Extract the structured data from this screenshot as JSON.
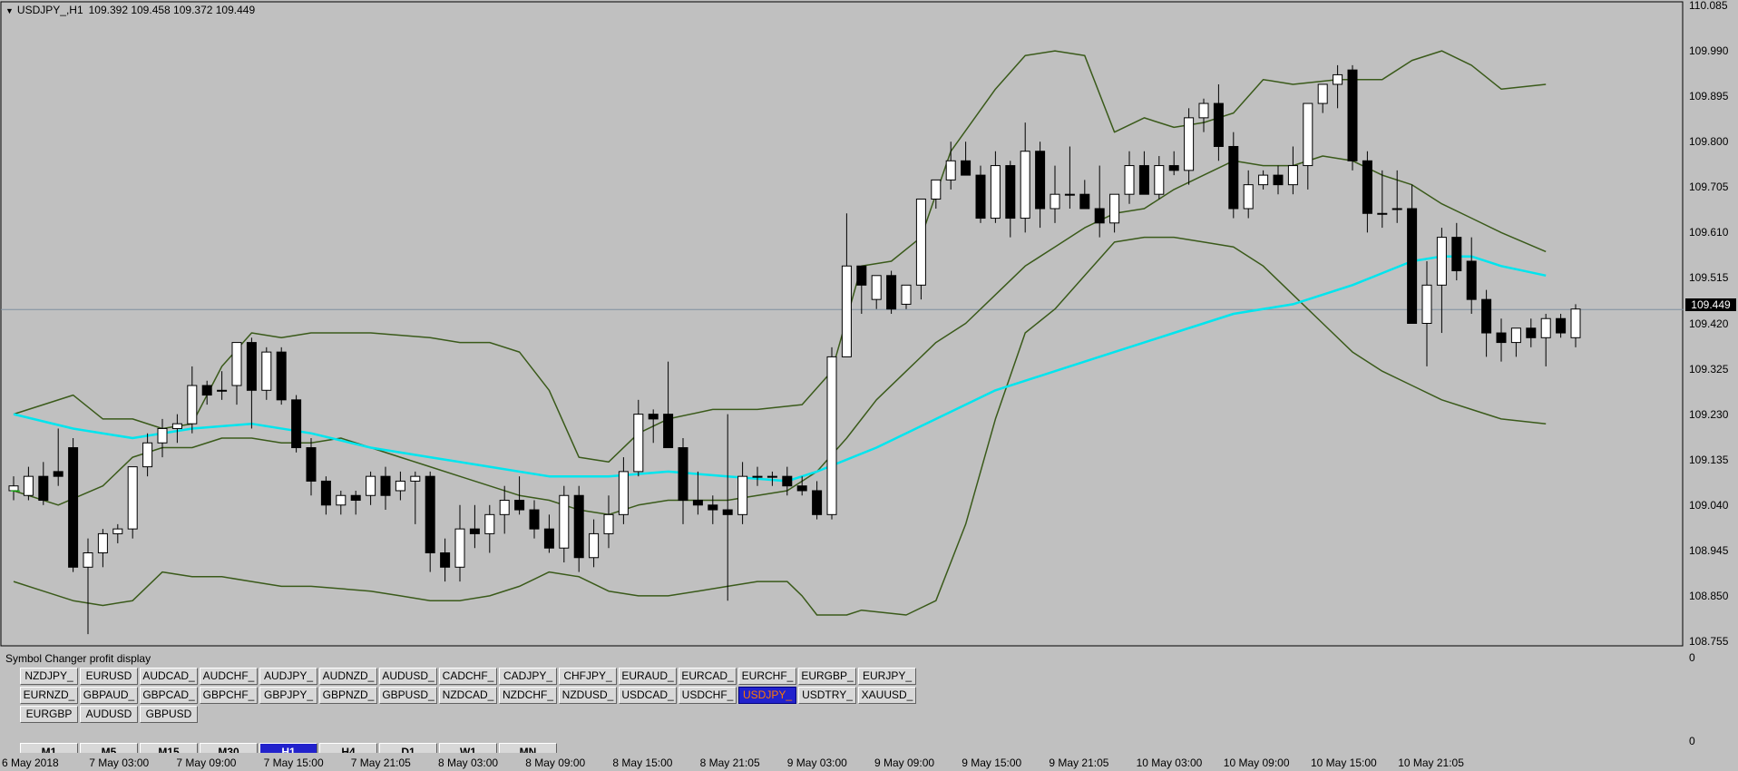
{
  "chart": {
    "symbol_title": "USDJPY_,H1",
    "ohlc": "109.392 109.458 109.372 109.449",
    "current_price": "109.449",
    "colors": {
      "background": "#c0c0c0",
      "bollinger": "#3a5a1a",
      "moving_average": "#00e5ee",
      "bull_candle": "#ffffff",
      "bear_candle": "#000000",
      "bid_line": "#7f90a0"
    },
    "price_axis": [
      "110.085",
      "109.990",
      "109.895",
      "109.800",
      "109.705",
      "109.610",
      "109.515",
      "109.420",
      "109.325",
      "109.230",
      "109.135",
      "109.040",
      "108.945",
      "108.850",
      "108.755"
    ],
    "time_axis": [
      "6 May 2018",
      "7 May 03:00",
      "7 May 09:00",
      "7 May 15:00",
      "7 May 21:05",
      "8 May 03:00",
      "8 May 09:00",
      "8 May 15:00",
      "8 May 21:05",
      "9 May 03:00",
      "9 May 09:00",
      "9 May 15:00",
      "9 May 21:05",
      "10 May 03:00",
      "10 May 09:00",
      "10 May 15:00",
      "10 May 21:05"
    ]
  },
  "chart_data": {
    "type": "candlestick",
    "ylim": [
      108.735,
      110.095
    ],
    "candles": [
      [
        109.07,
        109.1,
        109.05,
        109.08
      ],
      [
        109.06,
        109.12,
        109.05,
        109.1
      ],
      [
        109.1,
        109.13,
        109.04,
        109.05
      ],
      [
        109.11,
        109.2,
        109.08,
        109.1
      ],
      [
        109.16,
        109.18,
        108.9,
        108.91
      ],
      [
        108.91,
        108.97,
        108.77,
        108.94
      ],
      [
        108.94,
        108.99,
        108.91,
        108.98
      ],
      [
        108.98,
        109.0,
        108.96,
        108.99
      ],
      [
        108.99,
        109.12,
        108.97,
        109.12
      ],
      [
        109.12,
        109.19,
        109.1,
        109.17
      ],
      [
        109.17,
        109.22,
        109.14,
        109.2
      ],
      [
        109.2,
        109.23,
        109.17,
        109.21
      ],
      [
        109.21,
        109.33,
        109.19,
        109.29
      ],
      [
        109.29,
        109.3,
        109.25,
        109.27
      ],
      [
        109.28,
        109.32,
        109.26,
        109.28
      ],
      [
        109.29,
        109.38,
        109.25,
        109.38
      ],
      [
        109.38,
        109.39,
        109.2,
        109.28
      ],
      [
        109.28,
        109.37,
        109.26,
        109.36
      ],
      [
        109.36,
        109.37,
        109.25,
        109.26
      ],
      [
        109.26,
        109.27,
        109.15,
        109.16
      ],
      [
        109.16,
        109.18,
        109.06,
        109.09
      ],
      [
        109.09,
        109.1,
        109.02,
        109.04
      ],
      [
        109.04,
        109.07,
        109.02,
        109.06
      ],
      [
        109.06,
        109.07,
        109.02,
        109.05
      ],
      [
        109.06,
        109.11,
        109.04,
        109.1
      ],
      [
        109.1,
        109.12,
        109.03,
        109.06
      ],
      [
        109.07,
        109.11,
        109.05,
        109.09
      ],
      [
        109.09,
        109.11,
        109.0,
        109.1
      ],
      [
        109.1,
        109.11,
        108.9,
        108.94
      ],
      [
        108.94,
        108.97,
        108.88,
        108.91
      ],
      [
        108.91,
        109.04,
        108.88,
        108.99
      ],
      [
        108.99,
        109.04,
        108.95,
        108.98
      ],
      [
        108.98,
        109.04,
        108.94,
        109.02
      ],
      [
        109.02,
        109.08,
        108.98,
        109.05
      ],
      [
        109.05,
        109.1,
        109.02,
        109.03
      ],
      [
        109.03,
        109.05,
        108.97,
        108.99
      ],
      [
        108.99,
        109.02,
        108.94,
        108.95
      ],
      [
        108.95,
        109.08,
        108.92,
        109.06
      ],
      [
        109.06,
        109.08,
        108.9,
        108.93
      ],
      [
        108.93,
        109.01,
        108.91,
        108.98
      ],
      [
        108.98,
        109.06,
        108.95,
        109.02
      ],
      [
        109.02,
        109.14,
        109.0,
        109.11
      ],
      [
        109.11,
        109.26,
        109.1,
        109.23
      ],
      [
        109.23,
        109.24,
        109.17,
        109.22
      ],
      [
        109.23,
        109.34,
        109.16,
        109.16
      ],
      [
        109.16,
        109.18,
        109.0,
        109.05
      ],
      [
        109.05,
        109.11,
        109.02,
        109.04
      ],
      [
        109.04,
        109.06,
        109.0,
        109.03
      ],
      [
        109.03,
        109.23,
        108.84,
        109.02
      ],
      [
        109.02,
        109.13,
        109.0,
        109.1
      ],
      [
        109.1,
        109.12,
        109.08,
        109.1
      ],
      [
        109.1,
        109.11,
        109.08,
        109.1
      ],
      [
        109.1,
        109.12,
        109.06,
        109.08
      ],
      [
        109.08,
        109.1,
        109.06,
        109.07
      ],
      [
        109.07,
        109.09,
        109.01,
        109.02
      ],
      [
        109.02,
        109.37,
        109.01,
        109.35
      ],
      [
        109.35,
        109.65,
        109.35,
        109.54
      ],
      [
        109.54,
        109.54,
        109.44,
        109.5
      ],
      [
        109.47,
        109.52,
        109.45,
        109.52
      ],
      [
        109.52,
        109.53,
        109.44,
        109.45
      ],
      [
        109.46,
        109.5,
        109.45,
        109.5
      ],
      [
        109.5,
        109.67,
        109.47,
        109.68
      ],
      [
        109.68,
        109.7,
        109.66,
        109.72
      ],
      [
        109.72,
        109.8,
        109.7,
        109.76
      ],
      [
        109.76,
        109.8,
        109.73,
        109.73
      ],
      [
        109.73,
        109.75,
        109.63,
        109.64
      ],
      [
        109.64,
        109.78,
        109.63,
        109.75
      ],
      [
        109.75,
        109.76,
        109.6,
        109.64
      ],
      [
        109.64,
        109.84,
        109.61,
        109.78
      ],
      [
        109.78,
        109.8,
        109.62,
        109.66
      ],
      [
        109.66,
        109.75,
        109.63,
        109.69
      ],
      [
        109.69,
        109.79,
        109.66,
        109.69
      ],
      [
        109.69,
        109.72,
        109.66,
        109.66
      ],
      [
        109.66,
        109.75,
        109.6,
        109.63
      ],
      [
        109.63,
        109.68,
        109.61,
        109.69
      ],
      [
        109.69,
        109.78,
        109.67,
        109.75
      ],
      [
        109.75,
        109.78,
        109.69,
        109.69
      ],
      [
        109.69,
        109.77,
        109.68,
        109.75
      ],
      [
        109.75,
        109.78,
        109.73,
        109.74
      ],
      [
        109.74,
        109.87,
        109.71,
        109.85
      ],
      [
        109.85,
        109.89,
        109.82,
        109.88
      ],
      [
        109.88,
        109.92,
        109.76,
        109.79
      ],
      [
        109.79,
        109.82,
        109.64,
        109.66
      ],
      [
        109.66,
        109.74,
        109.64,
        109.71
      ],
      [
        109.71,
        109.74,
        109.7,
        109.73
      ],
      [
        109.73,
        109.75,
        109.69,
        109.71
      ],
      [
        109.71,
        109.79,
        109.69,
        109.75
      ],
      [
        109.75,
        109.88,
        109.7,
        109.88
      ],
      [
        109.88,
        109.92,
        109.86,
        109.92
      ],
      [
        109.92,
        109.96,
        109.87,
        109.94
      ],
      [
        109.95,
        109.96,
        109.74,
        109.76
      ],
      [
        109.76,
        109.78,
        109.61,
        109.65
      ],
      [
        109.65,
        109.74,
        109.62,
        109.65
      ],
      [
        109.66,
        109.74,
        109.63,
        109.66
      ],
      [
        109.66,
        109.71,
        109.42,
        109.42
      ],
      [
        109.42,
        109.55,
        109.33,
        109.5
      ],
      [
        109.5,
        109.62,
        109.4,
        109.6
      ],
      [
        109.6,
        109.63,
        109.51,
        109.53
      ],
      [
        109.55,
        109.6,
        109.44,
        109.47
      ],
      [
        109.47,
        109.49,
        109.35,
        109.4
      ],
      [
        109.4,
        109.43,
        109.34,
        109.38
      ],
      [
        109.38,
        109.41,
        109.35,
        109.41
      ],
      [
        109.41,
        109.43,
        109.37,
        109.39
      ],
      [
        109.39,
        109.44,
        109.33,
        109.43
      ],
      [
        109.43,
        109.44,
        109.39,
        109.4
      ],
      [
        109.39,
        109.46,
        109.37,
        109.45
      ]
    ],
    "bollinger_upper": [
      [
        0,
        109.23
      ],
      [
        2,
        109.25
      ],
      [
        4,
        109.27
      ],
      [
        6,
        109.22
      ],
      [
        8,
        109.22
      ],
      [
        10,
        109.2
      ],
      [
        12,
        109.21
      ],
      [
        14,
        109.33
      ],
      [
        16,
        109.4
      ],
      [
        18,
        109.39
      ],
      [
        20,
        109.4
      ],
      [
        24,
        109.4
      ],
      [
        28,
        109.39
      ],
      [
        30,
        109.38
      ],
      [
        32,
        109.38
      ],
      [
        34,
        109.36
      ],
      [
        36,
        109.28
      ],
      [
        38,
        109.14
      ],
      [
        40,
        109.13
      ],
      [
        42,
        109.19
      ],
      [
        44,
        109.22
      ],
      [
        47,
        109.24
      ],
      [
        50,
        109.24
      ],
      [
        53,
        109.25
      ],
      [
        55,
        109.32
      ],
      [
        57,
        109.54
      ],
      [
        59,
        109.55
      ],
      [
        61,
        109.6
      ],
      [
        63,
        109.78
      ],
      [
        66,
        109.91
      ],
      [
        68,
        109.98
      ],
      [
        70,
        109.99
      ],
      [
        72,
        109.98
      ],
      [
        74,
        109.82
      ],
      [
        76,
        109.85
      ],
      [
        78,
        109.83
      ],
      [
        80,
        109.84
      ],
      [
        82,
        109.86
      ],
      [
        84,
        109.93
      ],
      [
        86,
        109.92
      ],
      [
        89,
        109.93
      ],
      [
        92,
        109.93
      ],
      [
        94,
        109.97
      ],
      [
        96,
        109.99
      ],
      [
        98,
        109.96
      ],
      [
        100,
        109.91
      ],
      [
        103,
        109.92
      ]
    ],
    "bollinger_middle": [
      [
        0,
        109.07
      ],
      [
        3,
        109.04
      ],
      [
        6,
        109.08
      ],
      [
        8,
        109.14
      ],
      [
        10,
        109.16
      ],
      [
        12,
        109.16
      ],
      [
        14,
        109.18
      ],
      [
        16,
        109.18
      ],
      [
        18,
        109.17
      ],
      [
        20,
        109.17
      ],
      [
        22,
        109.18
      ],
      [
        24,
        109.16
      ],
      [
        26,
        109.14
      ],
      [
        28,
        109.12
      ],
      [
        30,
        109.1
      ],
      [
        32,
        109.08
      ],
      [
        34,
        109.06
      ],
      [
        36,
        109.05
      ],
      [
        38,
        109.03
      ],
      [
        40,
        109.02
      ],
      [
        42,
        109.04
      ],
      [
        44,
        109.05
      ],
      [
        46,
        109.05
      ],
      [
        48,
        109.05
      ],
      [
        50,
        109.06
      ],
      [
        52,
        109.07
      ],
      [
        54,
        109.11
      ],
      [
        56,
        109.18
      ],
      [
        58,
        109.26
      ],
      [
        60,
        109.32
      ],
      [
        62,
        109.38
      ],
      [
        64,
        109.42
      ],
      [
        66,
        109.48
      ],
      [
        68,
        109.54
      ],
      [
        70,
        109.58
      ],
      [
        72,
        109.62
      ],
      [
        74,
        109.65
      ],
      [
        76,
        109.66
      ],
      [
        78,
        109.7
      ],
      [
        80,
        109.73
      ],
      [
        82,
        109.76
      ],
      [
        84,
        109.75
      ],
      [
        86,
        109.75
      ],
      [
        88,
        109.77
      ],
      [
        90,
        109.76
      ],
      [
        92,
        109.73
      ],
      [
        94,
        109.71
      ],
      [
        96,
        109.67
      ],
      [
        98,
        109.64
      ],
      [
        100,
        109.61
      ],
      [
        103,
        109.57
      ]
    ],
    "bollinger_lower": [
      [
        0,
        108.88
      ],
      [
        2,
        108.86
      ],
      [
        4,
        108.84
      ],
      [
        6,
        108.83
      ],
      [
        8,
        108.84
      ],
      [
        10,
        108.9
      ],
      [
        12,
        108.89
      ],
      [
        14,
        108.89
      ],
      [
        16,
        108.88
      ],
      [
        18,
        108.87
      ],
      [
        20,
        108.87
      ],
      [
        24,
        108.86
      ],
      [
        26,
        108.85
      ],
      [
        28,
        108.84
      ],
      [
        30,
        108.84
      ],
      [
        32,
        108.85
      ],
      [
        34,
        108.87
      ],
      [
        36,
        108.9
      ],
      [
        38,
        108.89
      ],
      [
        40,
        108.86
      ],
      [
        42,
        108.85
      ],
      [
        44,
        108.85
      ],
      [
        46,
        108.86
      ],
      [
        48,
        108.87
      ],
      [
        50,
        108.88
      ],
      [
        52,
        108.88
      ],
      [
        53,
        108.85
      ],
      [
        54,
        108.81
      ],
      [
        56,
        108.81
      ],
      [
        57,
        108.82
      ],
      [
        60,
        108.81
      ],
      [
        62,
        108.84
      ],
      [
        64,
        109.0
      ],
      [
        66,
        109.22
      ],
      [
        68,
        109.4
      ],
      [
        70,
        109.45
      ],
      [
        72,
        109.52
      ],
      [
        74,
        109.59
      ],
      [
        76,
        109.6
      ],
      [
        78,
        109.6
      ],
      [
        80,
        109.59
      ],
      [
        82,
        109.58
      ],
      [
        84,
        109.54
      ],
      [
        86,
        109.48
      ],
      [
        88,
        109.42
      ],
      [
        90,
        109.36
      ],
      [
        92,
        109.32
      ],
      [
        94,
        109.29
      ],
      [
        96,
        109.26
      ],
      [
        98,
        109.24
      ],
      [
        100,
        109.22
      ],
      [
        103,
        109.21
      ]
    ],
    "moving_average": [
      [
        0,
        109.23
      ],
      [
        4,
        109.2
      ],
      [
        8,
        109.18
      ],
      [
        12,
        109.2
      ],
      [
        16,
        109.21
      ],
      [
        20,
        109.19
      ],
      [
        24,
        109.16
      ],
      [
        28,
        109.14
      ],
      [
        32,
        109.12
      ],
      [
        36,
        109.1
      ],
      [
        40,
        109.1
      ],
      [
        44,
        109.11
      ],
      [
        48,
        109.1
      ],
      [
        52,
        109.09
      ],
      [
        54,
        109.11
      ],
      [
        58,
        109.16
      ],
      [
        62,
        109.22
      ],
      [
        66,
        109.28
      ],
      [
        70,
        109.32
      ],
      [
        74,
        109.36
      ],
      [
        78,
        109.4
      ],
      [
        82,
        109.44
      ],
      [
        86,
        109.46
      ],
      [
        90,
        109.5
      ],
      [
        94,
        109.55
      ],
      [
        96,
        109.56
      ],
      [
        98,
        109.56
      ],
      [
        100,
        109.54
      ],
      [
        103,
        109.52
      ]
    ]
  },
  "panel": {
    "title": "Symbol Changer profit display",
    "right_top_label": "0",
    "right_bottom_label": "0",
    "symbols": [
      [
        "NZDJPY_",
        "EURUSD",
        "AUDCAD_",
        "AUDCHF_",
        "AUDJPY_",
        "AUDNZD_",
        "AUDUSD_",
        "CADCHF_",
        "CADJPY_",
        "CHFJPY_",
        "EURAUD_",
        "EURCAD_",
        "EURCHF_",
        "EURGBP_",
        "EURJPY_"
      ],
      [
        "EURNZD_",
        "GBPAUD_",
        "GBPCAD_",
        "GBPCHF_",
        "GBPJPY_",
        "GBPNZD_",
        "GBPUSD_",
        "NZDCAD_",
        "NZDCHF_",
        "NZDUSD_",
        "USDCAD_",
        "USDCHF_",
        "USDJPY_",
        "USDTRY_",
        "XAUUSD_"
      ],
      [
        "EURGBP",
        "AUDUSD",
        "GBPUSD"
      ]
    ],
    "active_symbol": "USDJPY_",
    "timeframes": [
      "M1",
      "M5",
      "M15",
      "M30",
      "H1",
      "H4",
      "D1",
      "W1",
      "MN"
    ],
    "active_timeframe": "H1"
  }
}
